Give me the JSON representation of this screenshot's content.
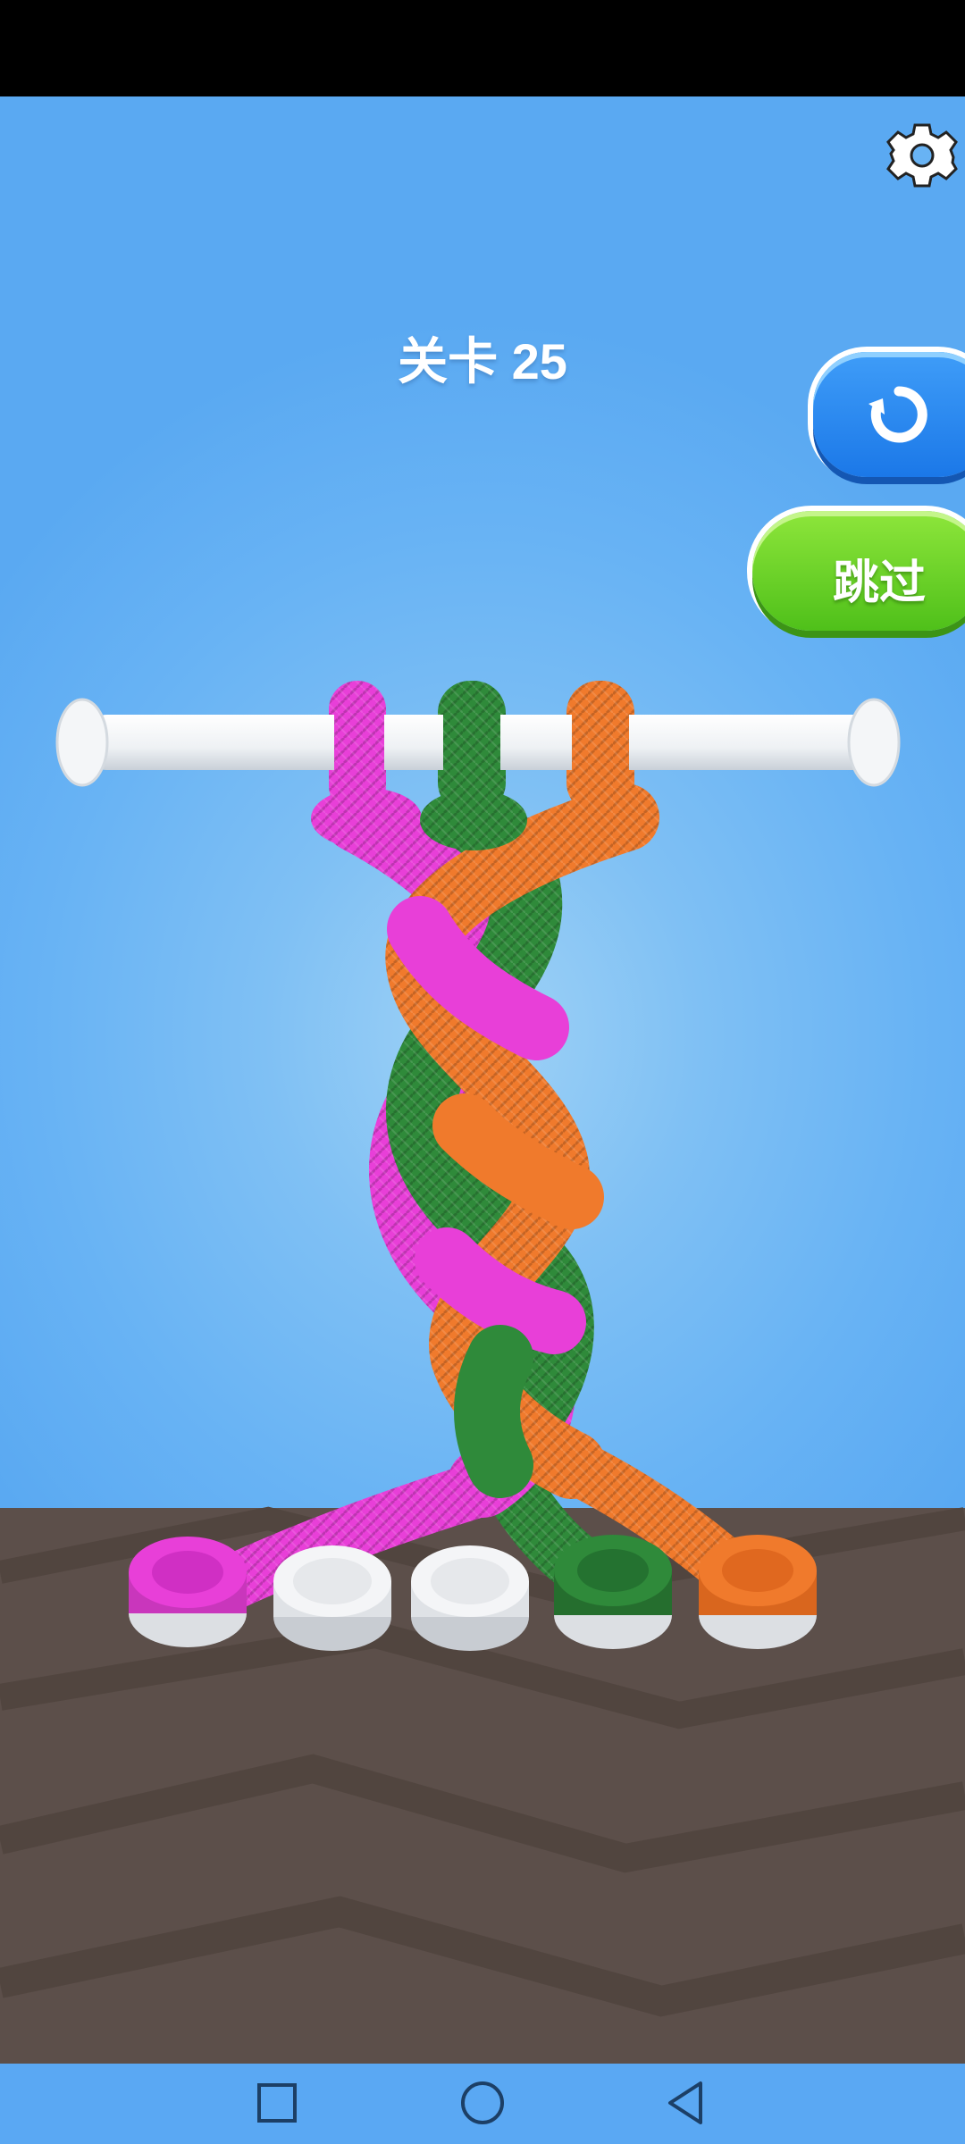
{
  "hud": {
    "level_label": "关卡 25",
    "skip_label": "跳过"
  },
  "icons": {
    "settings": "gear-icon",
    "undo": "undo-icon",
    "nav_recent": "square-icon",
    "nav_home": "circle-icon",
    "nav_back": "triangle-back-icon"
  },
  "ropes": [
    {
      "color": "pink",
      "hex": "#e83fd8"
    },
    {
      "color": "green",
      "hex": "#2f8a3a"
    },
    {
      "color": "orange",
      "hex": "#f07a2c"
    }
  ],
  "pegs": [
    {
      "slot": 1,
      "state": "pink",
      "hex": "#e83fd8"
    },
    {
      "slot": 2,
      "state": "empty",
      "hex": "#e8eaec"
    },
    {
      "slot": 3,
      "state": "empty",
      "hex": "#e8eaec"
    },
    {
      "slot": 4,
      "state": "green",
      "hex": "#2f8a3a"
    },
    {
      "slot": 5,
      "state": "orange",
      "hex": "#f07a2c"
    }
  ],
  "colors": {
    "sky": "#68b3f4",
    "table": "#5c4f4a",
    "skip_button": "#5fcd22",
    "undo_button": "#2a8af2"
  }
}
